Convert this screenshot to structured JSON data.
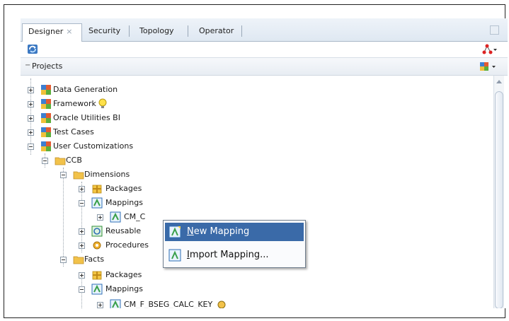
{
  "tabs": [
    {
      "label": "Designer",
      "active": true,
      "closable": true
    },
    {
      "label": "Security"
    },
    {
      "label": "Topology"
    },
    {
      "label": "Operator"
    }
  ],
  "projects_header": {
    "title": "Projects"
  },
  "tree": {
    "root_items": [
      "Data Generation",
      "Framework",
      "Oracle Utilities BI",
      "Test Cases",
      "User Customizations"
    ],
    "ccb": "CCB",
    "dimensions": "Dimensions",
    "dim_packages": "Packages",
    "dim_mappings": "Mappings",
    "dim_mapping_child": "CM_C",
    "dim_reusable": "Reusable",
    "dim_procedures": "Procedures",
    "facts": "Facts",
    "facts_packages": "Packages",
    "facts_mappings": "Mappings",
    "facts_mapping_child": "CM_F_BSEG_CALC_KEY"
  },
  "context_menu": {
    "new_mapping_prefix": "",
    "new_mapping_accel": "N",
    "new_mapping_rest": "ew Mapping",
    "import_prefix": "",
    "import_accel": "I",
    "import_rest": "mport Mapping..."
  },
  "colors": {
    "highlight": "#3a6aa8",
    "folder": "#f2c24a",
    "tab_bg": "#dfe8f2"
  }
}
